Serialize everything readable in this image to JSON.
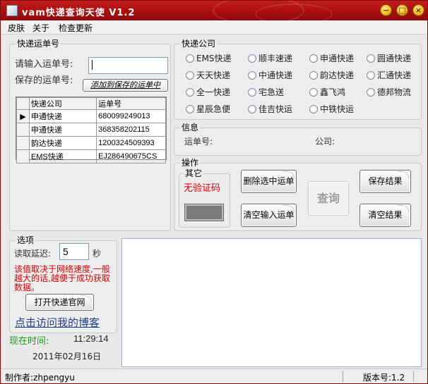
{
  "window": {
    "title": "vam快递查询天使 V1.2",
    "controls": {
      "minimize": "−",
      "maximize": "□",
      "close": "×"
    }
  },
  "menu": {
    "items": [
      "皮肤",
      "关于",
      "检查更新"
    ]
  },
  "tracking": {
    "group_title": "快递运单号",
    "input_label": "请输入运单号:",
    "input_value": "",
    "saved_label": "保存的运单号:",
    "add_button": "添加到保存的运单中",
    "columns": [
      "快递公司",
      "运单号"
    ],
    "rows": [
      {
        "company": "申通快递",
        "number": "680099249013",
        "selected": true
      },
      {
        "company": "申通快递",
        "number": "368358202115",
        "selected": false
      },
      {
        "company": "韵达快递",
        "number": "1200324509393",
        "selected": false
      },
      {
        "company": "EMS快递",
        "number": "EJ286490675CS",
        "selected": false
      }
    ]
  },
  "companies": {
    "group_title": "快递公司",
    "options": [
      "EMS快递",
      "顺丰速递",
      "申通快递",
      "圆通快递",
      "天天快递",
      "中通快递",
      "韵达快递",
      "汇通快递",
      "全一快递",
      "宅急送",
      "鑫飞鸿",
      "德邦物流",
      "星辰急便",
      "佳吉快运",
      "中铁快运"
    ]
  },
  "info": {
    "group_title": "信息",
    "number_label": "运单号:",
    "company_label": "公司:"
  },
  "actions": {
    "group_title": "操作",
    "other_title": "其它",
    "captcha_text": "无验证码",
    "delete_selected": "删除选中运单",
    "clear_input": "清空输入运单",
    "query": "查询",
    "save_results": "保存结果",
    "clear_results": "清空结果"
  },
  "options": {
    "group_title": "选项",
    "delay_label": "读取延迟:",
    "delay_value": "5",
    "delay_unit": "秒",
    "note": "该值取决于网络速度,一般越大的话,越便于成功获取数据。",
    "open_site_button": "打开快递官网",
    "blog_link": "点击访问我的博客",
    "time_label": "现在时间:",
    "time_value": "11:29:14",
    "date_value": "2011年02月16日"
  },
  "results_text": "",
  "status": {
    "author": "制作者:zhpengyu",
    "version": "版本号:1.2"
  },
  "colors": {
    "title_bar": "#a80f0f",
    "warning_text": "#d40000",
    "time_label": "#1a9a1a",
    "blog_link": "#1f3f88",
    "captcha_fill": "#7a7a7a"
  }
}
